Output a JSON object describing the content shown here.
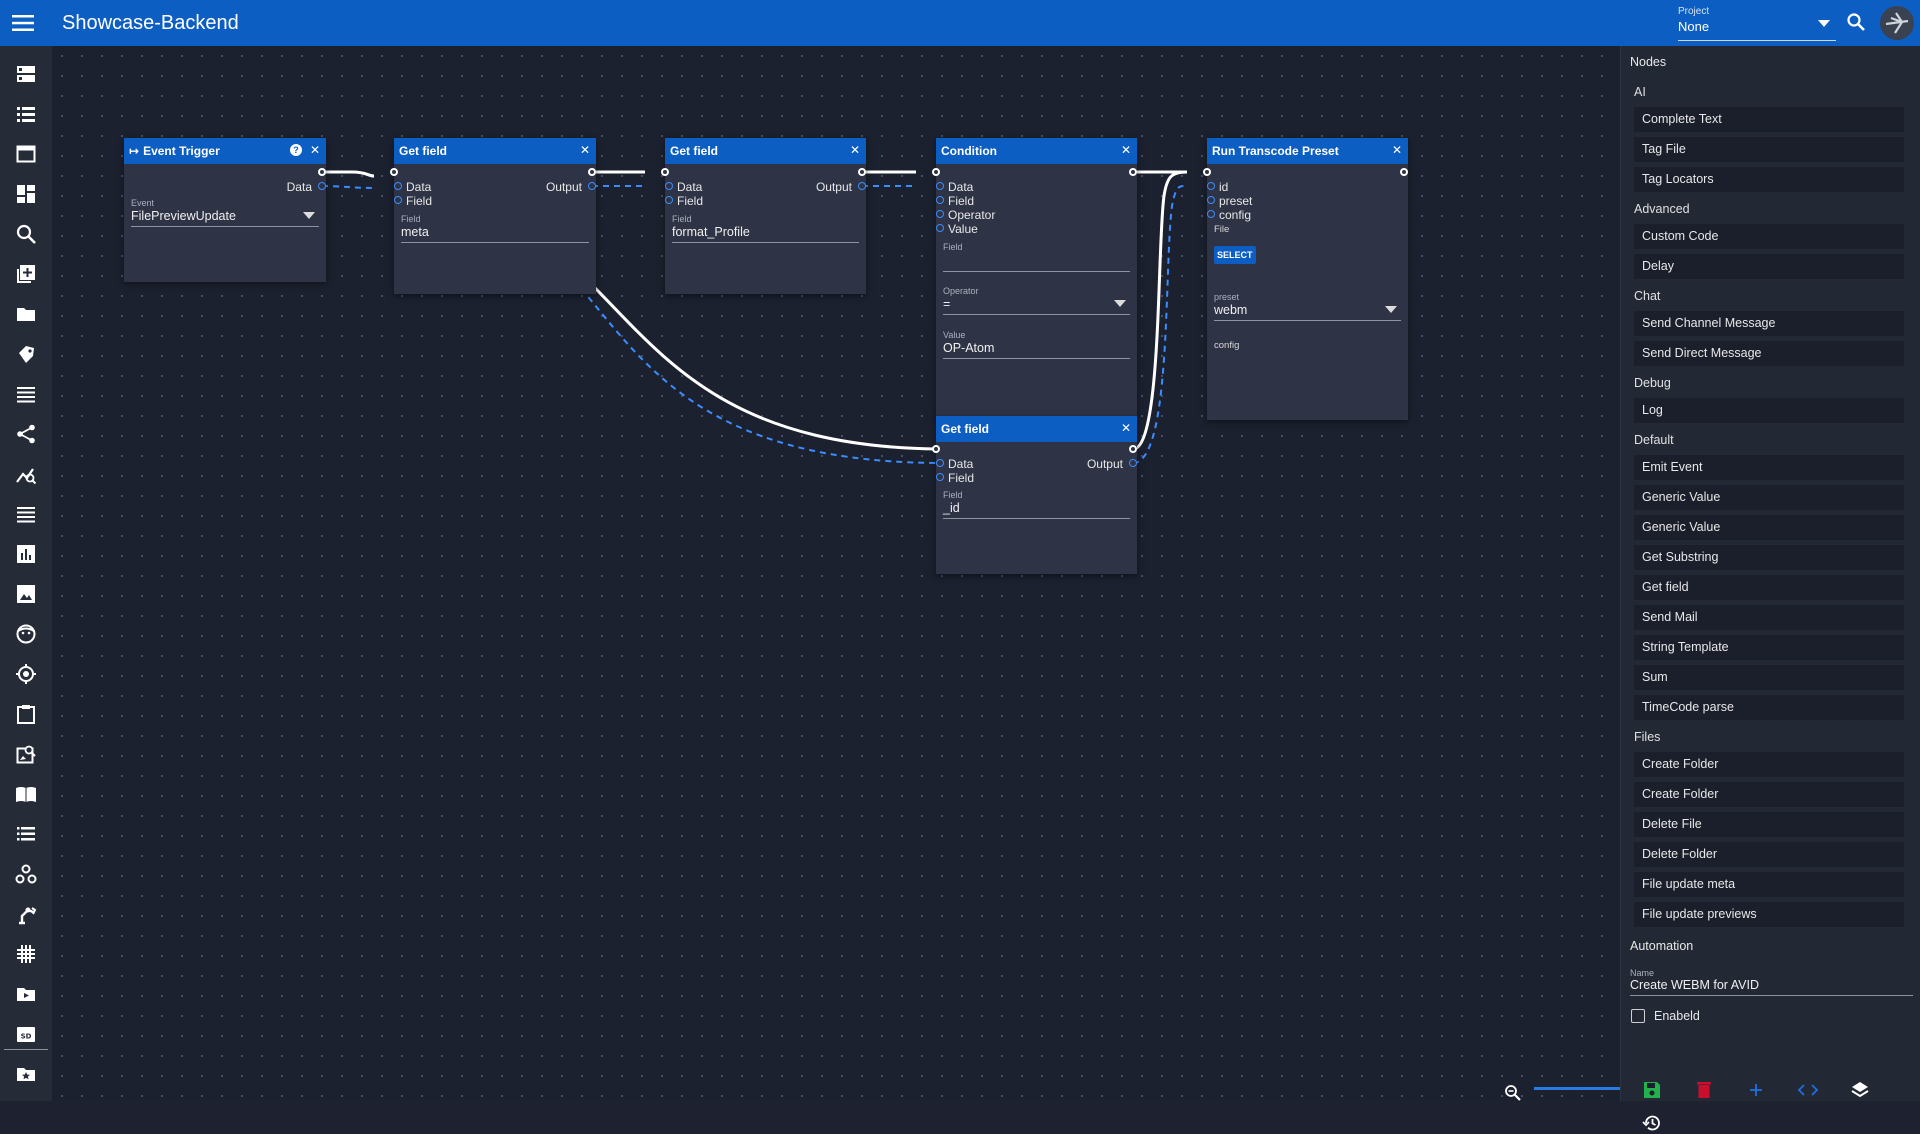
{
  "app": {
    "title": "Showcase-Backend"
  },
  "project": {
    "label": "Project",
    "value": "None"
  },
  "nodes": {
    "event_trigger": {
      "title": "Event Trigger",
      "help": "?",
      "close": "✕",
      "output_label": "Data",
      "field_label": "Event",
      "field_value": "FilePreviewUpdate"
    },
    "get_field_1": {
      "title": "Get field",
      "close": "✕",
      "inputs": [
        "Data",
        "Field"
      ],
      "output_label": "Output",
      "field_label": "Field",
      "field_value": "meta"
    },
    "get_field_2": {
      "title": "Get field",
      "close": "✕",
      "inputs": [
        "Data",
        "Field"
      ],
      "output_label": "Output",
      "field_label": "Field",
      "field_value": "format_Profile"
    },
    "condition": {
      "title": "Condition",
      "close": "✕",
      "inputs": [
        "Data",
        "Field",
        "Operator",
        "Value"
      ],
      "field_label": "Field",
      "field_value": "",
      "operator_label": "Operator",
      "operator_value": "=",
      "value_label": "Value",
      "value_value": "OP-Atom"
    },
    "run_transcode": {
      "title": "Run Transcode Preset",
      "close": "✕",
      "inputs": [
        "id",
        "preset",
        "config"
      ],
      "file_label": "File",
      "select_label": "SELECT",
      "preset_label": "preset",
      "preset_value": "webm",
      "config_label": "config"
    },
    "get_field_3": {
      "title": "Get field",
      "close": "✕",
      "inputs": [
        "Data",
        "Field"
      ],
      "output_label": "Output",
      "field_label": "Field",
      "field_value": "_id"
    }
  },
  "panel": {
    "title": "Nodes",
    "categories": [
      {
        "name": "AI",
        "items": [
          "Complete Text",
          "Tag File",
          "Tag Locators"
        ]
      },
      {
        "name": "Advanced",
        "items": [
          "Custom Code",
          "Delay"
        ]
      },
      {
        "name": "Chat",
        "items": [
          "Send Channel Message",
          "Send Direct Message"
        ]
      },
      {
        "name": "Debug",
        "items": [
          "Log"
        ]
      },
      {
        "name": "Default",
        "items": [
          "Emit Event",
          "Generic Value",
          "Generic Value",
          "Get Substring",
          "Get field",
          "Send Mail",
          "String Template",
          "Sum",
          "TimeCode parse"
        ]
      },
      {
        "name": "Files",
        "items": [
          "Create Folder",
          "Create Folder",
          "Delete File",
          "Delete Folder",
          "File update meta",
          "File update previews"
        ]
      }
    ],
    "automation": {
      "title": "Automation",
      "name_label": "Name",
      "name_value": "Create WEBM for AVID",
      "enabled_label": "Enabeld"
    }
  },
  "colors": {
    "topbar": "#0d5ec2",
    "canvas": "#1c2130",
    "node_header": "#0d5ec2",
    "port": "#3b8cff",
    "save": "#22b14c",
    "delete": "#c8102e",
    "add": "#1e6fe0"
  },
  "icons": {
    "leftbar": [
      "server-icon",
      "list-icon",
      "window-icon",
      "dashboard-icon",
      "search-icon",
      "add-box-icon",
      "folder-icon",
      "tag-icon",
      "lines-icon",
      "share-icon",
      "analytics-icon",
      "list-alt-icon",
      "bar-chart-icon",
      "image-icon",
      "face-icon",
      "target-icon",
      "assignment-icon",
      "image-search-icon",
      "book-icon",
      "list-bullets-icon",
      "webhook-icon",
      "robot-arm-icon",
      "grid-icon",
      "video-folder-icon",
      "sd-card-icon",
      "folder-star-icon"
    ],
    "actions": [
      "save-icon",
      "delete-icon",
      "add-icon",
      "code-icon",
      "layers-icon",
      "history-icon"
    ]
  }
}
